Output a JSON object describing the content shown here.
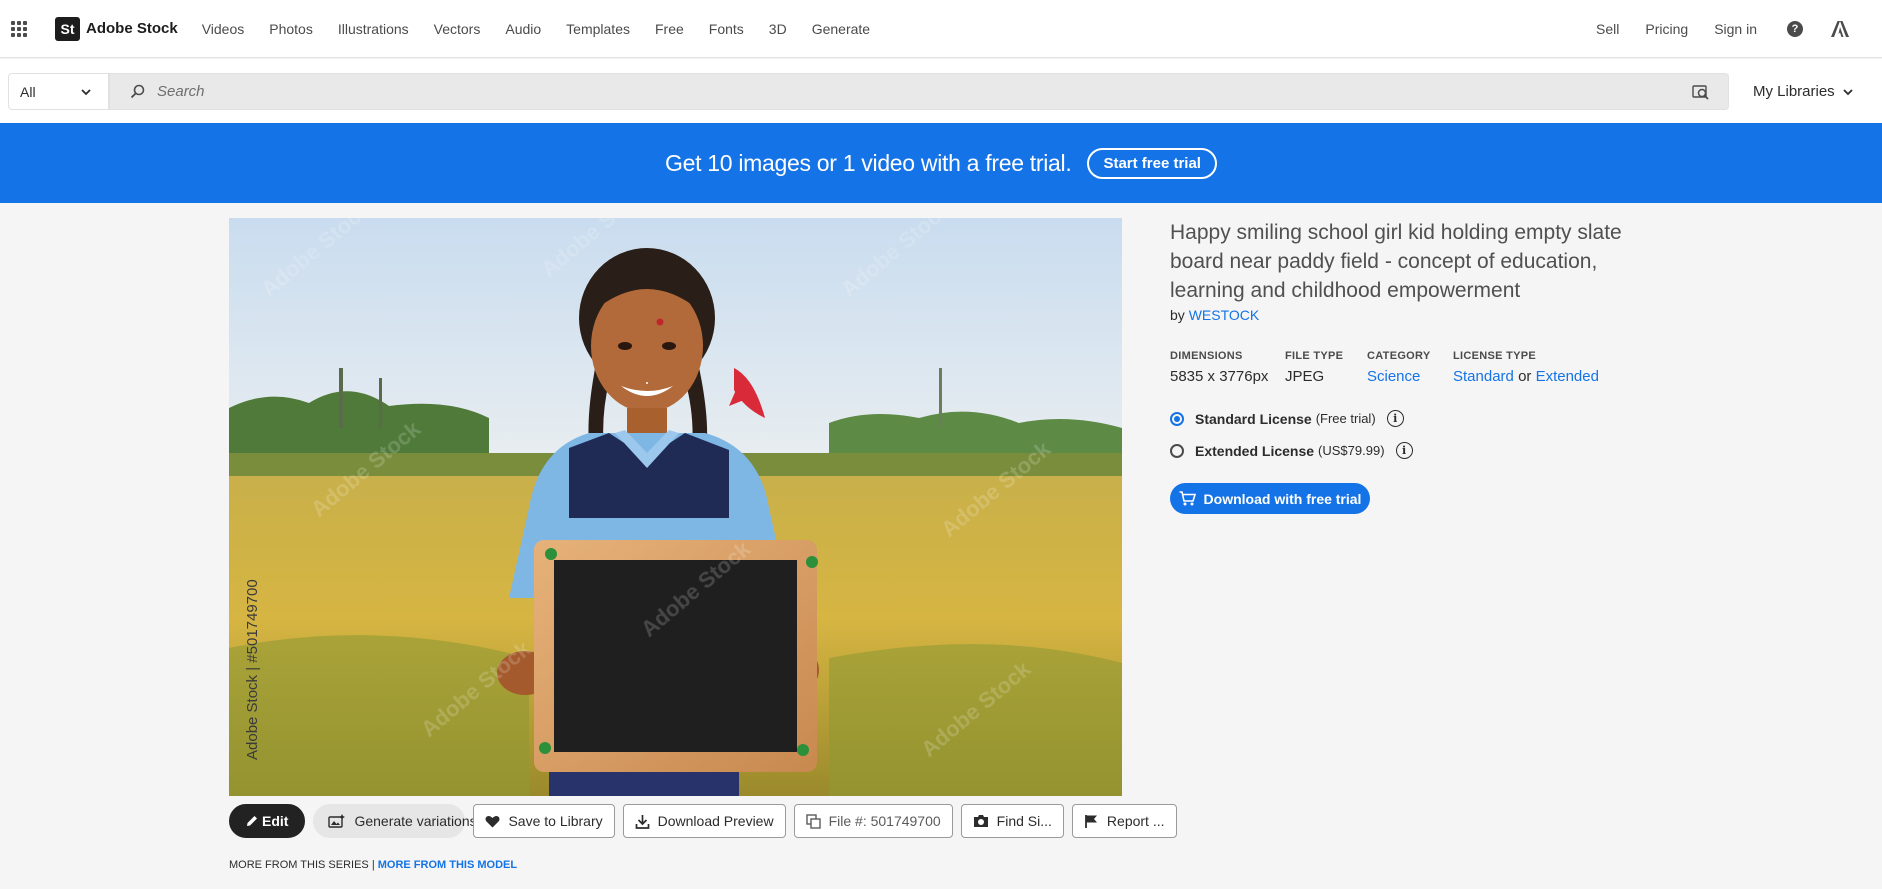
{
  "brand": {
    "mark": "St",
    "name": "Adobe Stock"
  },
  "nav": {
    "items": [
      "Videos",
      "Photos",
      "Illustrations",
      "Vectors",
      "Audio",
      "Templates",
      "Free",
      "Fonts",
      "3D",
      "Generate"
    ],
    "right": [
      "Sell",
      "Pricing",
      "Sign in"
    ],
    "help": "?"
  },
  "search": {
    "filter": "All",
    "placeholder": "Search",
    "libraries": "My Libraries"
  },
  "promo": {
    "text": "Get 10 images or 1 video with a free trial.",
    "button": "Start free trial"
  },
  "asset": {
    "watermark_id": "Adobe Stock | #501749700",
    "title": "Happy smiling school girl kid holding empty slate board near paddy field - concept of education, learning and childhood empowerment",
    "by_prefix": "by",
    "author": "WESTOCK",
    "meta": {
      "dimensions_label": "DIMENSIONS",
      "dimensions": "5835 x 3776px",
      "filetype_label": "FILE TYPE",
      "filetype": "JPEG",
      "category_label": "CATEGORY",
      "category": "Science",
      "license_label": "LICENSE TYPE",
      "license_standard": "Standard",
      "license_or": "or",
      "license_extended": "Extended"
    },
    "licenses": [
      {
        "name": "Standard License",
        "price": "(Free trial)",
        "selected": true
      },
      {
        "name": "Extended License",
        "price": "(US$79.99)",
        "selected": false
      }
    ],
    "download_button": "Download with free trial"
  },
  "toolbar": {
    "edit": "Edit",
    "generate": "Generate variations",
    "save": "Save to Library",
    "preview": "Download Preview",
    "file": "File #: 501749700",
    "find": "Find Si...",
    "report": "Report ..."
  },
  "series": {
    "series_label": "MORE FROM THIS SERIES",
    "separator": "|",
    "model_label": "MORE FROM THIS MODEL"
  },
  "colors": {
    "accent": "#1473e6",
    "banner": "#1473e6",
    "dark": "#222222"
  }
}
